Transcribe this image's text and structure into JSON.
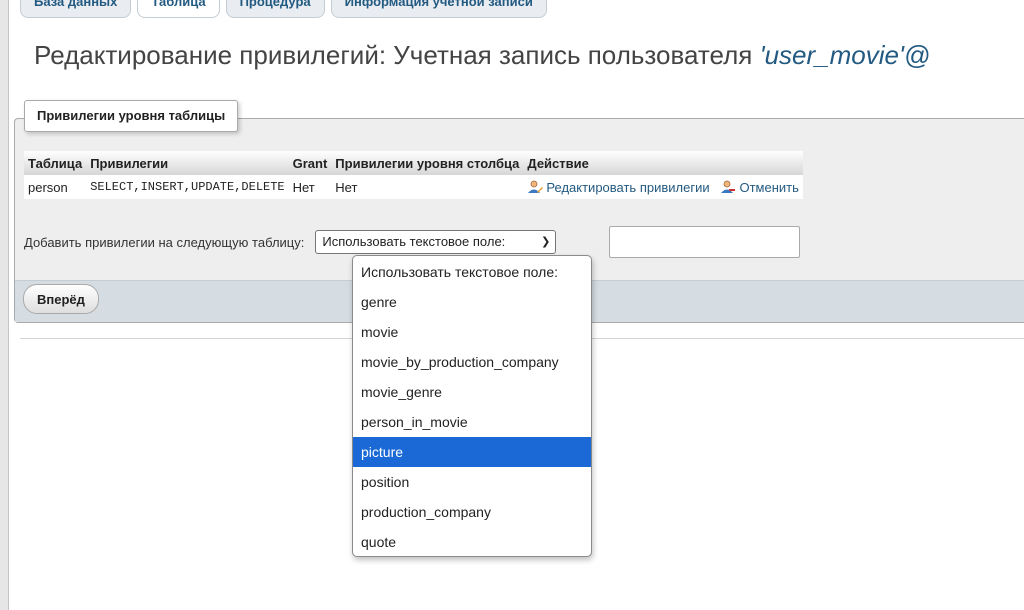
{
  "tabs": [
    {
      "label": "База данных"
    },
    {
      "label": "Таблица"
    },
    {
      "label": "Процедура"
    },
    {
      "label": "Информация учетной записи"
    }
  ],
  "title": {
    "prefix": "Редактирование привилегий: Учетная запись пользователя ",
    "account": "'user_movie'@"
  },
  "legend": "Привилегии уровня таблицы",
  "table": {
    "headers": {
      "table": "Таблица",
      "privileges": "Привилегии",
      "grant": "Grant",
      "column_privileges": "Привилегии уровня столбца",
      "action": "Действие"
    },
    "row": {
      "table": "person",
      "privileges": "SELECT,INSERT,UPDATE,DELETE",
      "grant": "Нет",
      "column_privileges": "Нет",
      "edit_label": "Редактировать привилегии",
      "revoke_label": "Отменить"
    }
  },
  "add": {
    "label": "Добавить привилегии на следующую таблицу:",
    "selected": "Использовать текстовое поле:"
  },
  "go_label": "Вперёд",
  "dropdown": {
    "options": [
      "Использовать текстовое поле:",
      "genre",
      "movie",
      "movie_by_production_company",
      "movie_genre",
      "person_in_movie",
      "picture",
      "position",
      "production_company",
      "quote"
    ],
    "highlighted": "picture"
  },
  "colors": {
    "link": "#235a81",
    "highlight": "#1a69d6"
  }
}
